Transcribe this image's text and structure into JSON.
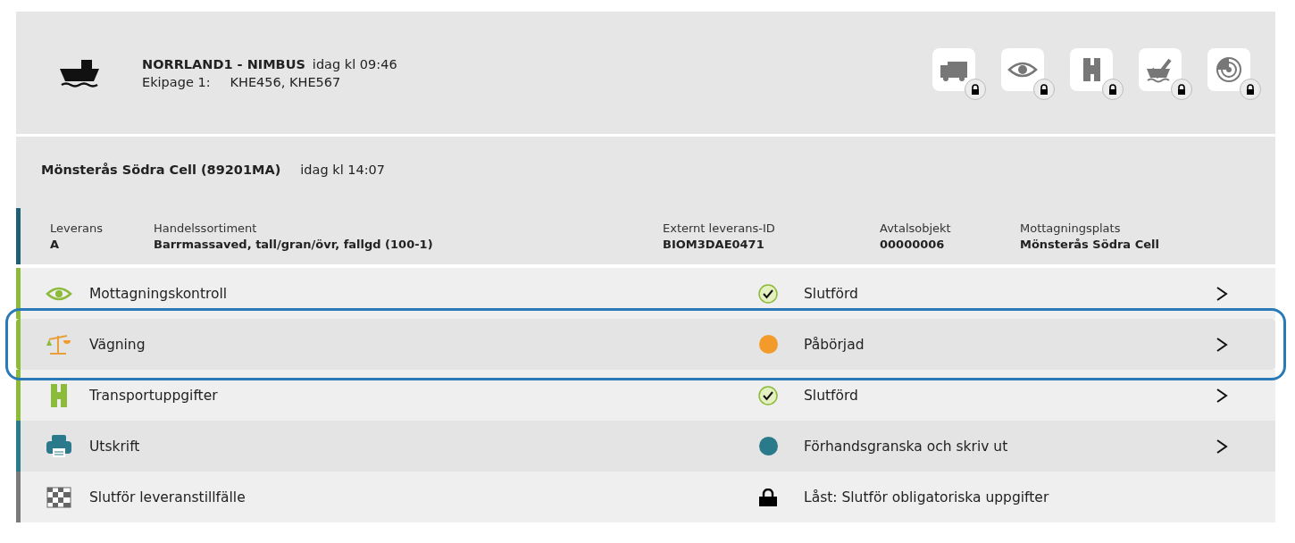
{
  "header": {
    "vessel": "NORRLAND1 - NIMBUS",
    "time": "idag kl 09:46",
    "crew_label": "Ekipage 1:",
    "crew_value": "KHE456, KHE567",
    "tools": [
      {
        "kind": "truck",
        "locked": true
      },
      {
        "kind": "eye",
        "locked": true
      },
      {
        "kind": "road",
        "locked": true
      },
      {
        "kind": "ship-check",
        "locked": true
      },
      {
        "kind": "radar",
        "locked": true
      }
    ]
  },
  "station": {
    "name": "Mönsterås Södra Cell (89201MA)",
    "time": "idag kl 14:07"
  },
  "delivery": [
    {
      "label": "Leverans",
      "value": "A"
    },
    {
      "label": "Handelssortiment",
      "value": "Barrmassaved, tall/gran/övr, fallgd (100-1)"
    },
    {
      "label": "Externt leverans-ID",
      "value": "BIOM3DAE0471"
    },
    {
      "label": "Avtalsobjekt",
      "value": "00000006"
    },
    {
      "label": "Mottagningsplats",
      "value": "Mönsterås Södra Cell"
    }
  ],
  "tasks": [
    {
      "label": "Mottagningskontroll",
      "status": {
        "kind": "done",
        "text": "Slutförd"
      },
      "arrow": true,
      "selected": false,
      "color": "#8cba3a"
    },
    {
      "label": "Vägning",
      "status": {
        "kind": "started",
        "text": "Påbörjad"
      },
      "arrow": true,
      "selected": true,
      "color": "#8cba3a"
    },
    {
      "label": "Transportuppgifter",
      "status": {
        "kind": "done",
        "text": "Slutförd"
      },
      "arrow": true,
      "selected": false,
      "color": "#8cba3a"
    },
    {
      "label": "Utskrift",
      "status": {
        "kind": "info",
        "text": "Förhandsgranska och skriv ut"
      },
      "arrow": true,
      "selected": false,
      "color": "#2b7a8c"
    },
    {
      "label": "Slutför leveranstillfälle",
      "status": {
        "kind": "locked",
        "text": "Låst: Slutför obligatoriska uppgifter"
      },
      "arrow": false,
      "selected": false,
      "color": "#7a7a7a"
    }
  ]
}
